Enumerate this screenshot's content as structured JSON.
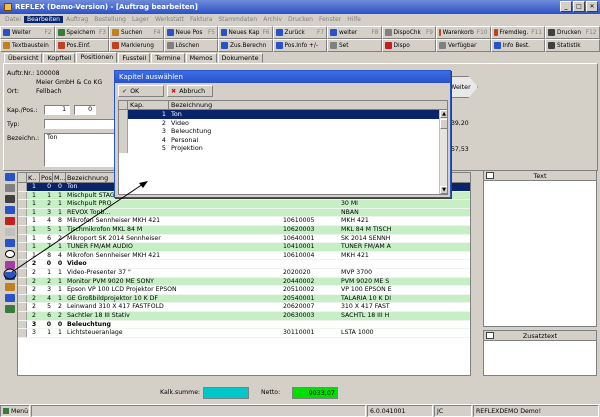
{
  "window": {
    "title": "REFLEX (Demo-Version) - [Auftrag bearbeiten]",
    "btn_min": "_",
    "btn_max": "□",
    "btn_close": "✕"
  },
  "menu": [
    "Datei",
    "Bearbeiten",
    "Auftrag",
    "Bestellung",
    "Lager",
    "Werkstatt",
    "Faktura",
    "Stammdaten",
    "Archiv",
    "Drucken",
    "Fenster",
    "Hilfe"
  ],
  "toolbar1": [
    {
      "label": "Weiter",
      "fkey": "F2",
      "color": "#2a52c7"
    },
    {
      "label": "Speichern",
      "fkey": "F3",
      "color": "#3a7a3a"
    },
    {
      "label": "Suchen",
      "fkey": "F4",
      "color": "#c08020"
    },
    {
      "label": "Neue Pos",
      "fkey": "F5",
      "color": "#2a52c7"
    },
    {
      "label": "Neues Kap",
      "fkey": "F6",
      "color": "#2a52c7"
    },
    {
      "label": "Zurück",
      "fkey": "F7",
      "color": "#2a52c7"
    },
    {
      "label": "weiter",
      "fkey": "F8",
      "color": "#2a52c7"
    },
    {
      "label": "DispoChk",
      "fkey": "F9",
      "color": "#808080"
    },
    {
      "label": "Warenkorb",
      "fkey": "F10",
      "color": "#c04020"
    },
    {
      "label": "Fremdleg.",
      "fkey": "F11",
      "color": "#c04020"
    },
    {
      "label": "Drucken",
      "fkey": "F12",
      "color": "#404040"
    }
  ],
  "toolbar2": [
    {
      "label": "Textbaustein",
      "color": "#c08020"
    },
    {
      "label": "Pos.Einf.",
      "color": "#c04020"
    },
    {
      "label": "Markierung",
      "color": "#c04020"
    },
    {
      "label": "Löschen",
      "color": "#808080"
    },
    {
      "label": "Zus.Berechn",
      "color": "#2a52c7"
    },
    {
      "label": "Pos.Info +/-",
      "color": "#2a52c7"
    },
    {
      "label": "Set",
      "color": "#808080"
    },
    {
      "label": "Dispo",
      "color": "#c02020"
    },
    {
      "label": "Verfügbar",
      "color": "#808080"
    },
    {
      "label": "Info Best.",
      "color": "#2a52c7"
    },
    {
      "label": "Statistik",
      "color": "#404040"
    }
  ],
  "tabs": [
    "Übersicht",
    "Kopfteil",
    "Positionen",
    "Fussteil",
    "Termine",
    "Memos",
    "Dokumente"
  ],
  "order": {
    "nr_label": "Auftr.Nr.:",
    "nr": "100008",
    "kunde": "Meier GmbH & Co KG",
    "ort_label": "Ort:",
    "ort": "Fellbach",
    "kappos_label": "Kap./Pos.:",
    "kap": "1",
    "pos": "0",
    "typ_label": "Typ:",
    "bez_label": "Bezeichn.:",
    "bez": "Ton",
    "val1": "39,20",
    "val2": "57,53",
    "weiter": "Weiter"
  },
  "grid": {
    "headers": [
      "K..",
      "Pos",
      "M...",
      "Bezeichnung",
      "",
      ""
    ],
    "rows": [
      {
        "k": "1",
        "pos": "0",
        "m": "0",
        "bez": "Ton",
        "nr": "",
        "name": "",
        "style": "sel"
      },
      {
        "k": "1",
        "pos": "1",
        "m": "1",
        "bez": "Mischpult STAGE",
        "nr": "",
        "name": "ASTER",
        "style": "green"
      },
      {
        "k": "1",
        "pos": "2",
        "m": "1",
        "bez": "Mischpult PRO",
        "nr": "",
        "name": "30 MI",
        "style": "green"
      },
      {
        "k": "1",
        "pos": "3",
        "m": "1",
        "bez": "REVOX Tonb...",
        "nr": "",
        "name": "NBAN",
        "style": "green"
      },
      {
        "k": "1",
        "pos": "4",
        "m": "8",
        "bez": "Mikrofon Sennheiser MKH 421",
        "nr": "10610005",
        "name": "MKH 421",
        "style": "white"
      },
      {
        "k": "1",
        "pos": "5",
        "m": "1",
        "bez": "Tischmikrofon MKL 84 M",
        "nr": "10620003",
        "name": "MKL 84 M TISCH",
        "style": "green"
      },
      {
        "k": "1",
        "pos": "6",
        "m": "2",
        "bez": "Mikroport SK 2014 Sennheiser",
        "nr": "10640001",
        "name": "SK 2014 SENNH",
        "style": "white"
      },
      {
        "k": "1",
        "pos": "7",
        "m": "1",
        "bez": "TUNER FM/AM AUDIO",
        "nr": "10410001",
        "name": "TUNER FM/AM A",
        "style": "green"
      },
      {
        "k": "1",
        "pos": "8",
        "m": "4",
        "bez": "Mikrofon Sennheiser MKH 421",
        "nr": "10610004",
        "name": "MKH 421",
        "style": "white"
      },
      {
        "k": "2",
        "pos": "0",
        "m": "0",
        "bez": "Video",
        "nr": "",
        "name": "",
        "style": "hdr"
      },
      {
        "k": "2",
        "pos": "1",
        "m": "1",
        "bez": "Video-Presenter 37 \"",
        "nr": "2020020",
        "name": "MVP 3700",
        "style": "white"
      },
      {
        "k": "2",
        "pos": "2",
        "m": "1",
        "bez": "Monitor PVM 9020 ME SONY",
        "nr": "20440002",
        "name": "PVM 9020 ME S",
        "style": "green"
      },
      {
        "k": "2",
        "pos": "3",
        "m": "1",
        "bez": "Epson VP 100 LCD Projektor EPSON",
        "nr": "20510002",
        "name": "VP 100 EPSON E",
        "style": "white"
      },
      {
        "k": "2",
        "pos": "4",
        "m": "1",
        "bez": "GE Großbildprojektor 10 K DF",
        "nr": "20540001",
        "name": "TALARIA 10 K DI",
        "style": "green"
      },
      {
        "k": "2",
        "pos": "5",
        "m": "2",
        "bez": "Leinwand 310 X 417 FASTFOLD",
        "nr": "20620007",
        "name": "310 X 417 FAST",
        "style": "white"
      },
      {
        "k": "2",
        "pos": "6",
        "m": "2",
        "bez": "Sachtler 18 III Stativ",
        "nr": "20630003",
        "name": "SACHTL 18 III H",
        "style": "green"
      },
      {
        "k": "3",
        "pos": "0",
        "m": "0",
        "bez": "Beleuchtung",
        "nr": "",
        "name": "",
        "style": "hdr"
      },
      {
        "k": "3",
        "pos": "1",
        "m": "1",
        "bez": "Lichtsteueranlage",
        "nr": "30110001",
        "name": "LSTA 1000",
        "style": "white"
      }
    ]
  },
  "right": {
    "text_title": "Text",
    "zusatz_title": "Zusatztext"
  },
  "totals": {
    "kalk_label": "Kalk.summe:",
    "kalk_value": "",
    "netto_label": "Netto:",
    "netto_value": "9033,07"
  },
  "status": {
    "menu": "Menü",
    "version": "6.0.041001",
    "user": "JC",
    "demo": "REFLEXDEMO Demo!"
  },
  "dialog": {
    "title": "Kapitel auswählen",
    "ok": "OK",
    "abbruch": "Abbruch",
    "col_kap": "Kap.",
    "col_bez": "Bezeichnung",
    "items": [
      {
        "kap": "1",
        "bez": "Ton"
      },
      {
        "kap": "2",
        "bez": "Video"
      },
      {
        "kap": "3",
        "bez": "Beleuchtung"
      },
      {
        "kap": "4",
        "bez": "Personal"
      },
      {
        "kap": "5",
        "bez": "Projektion"
      }
    ]
  }
}
